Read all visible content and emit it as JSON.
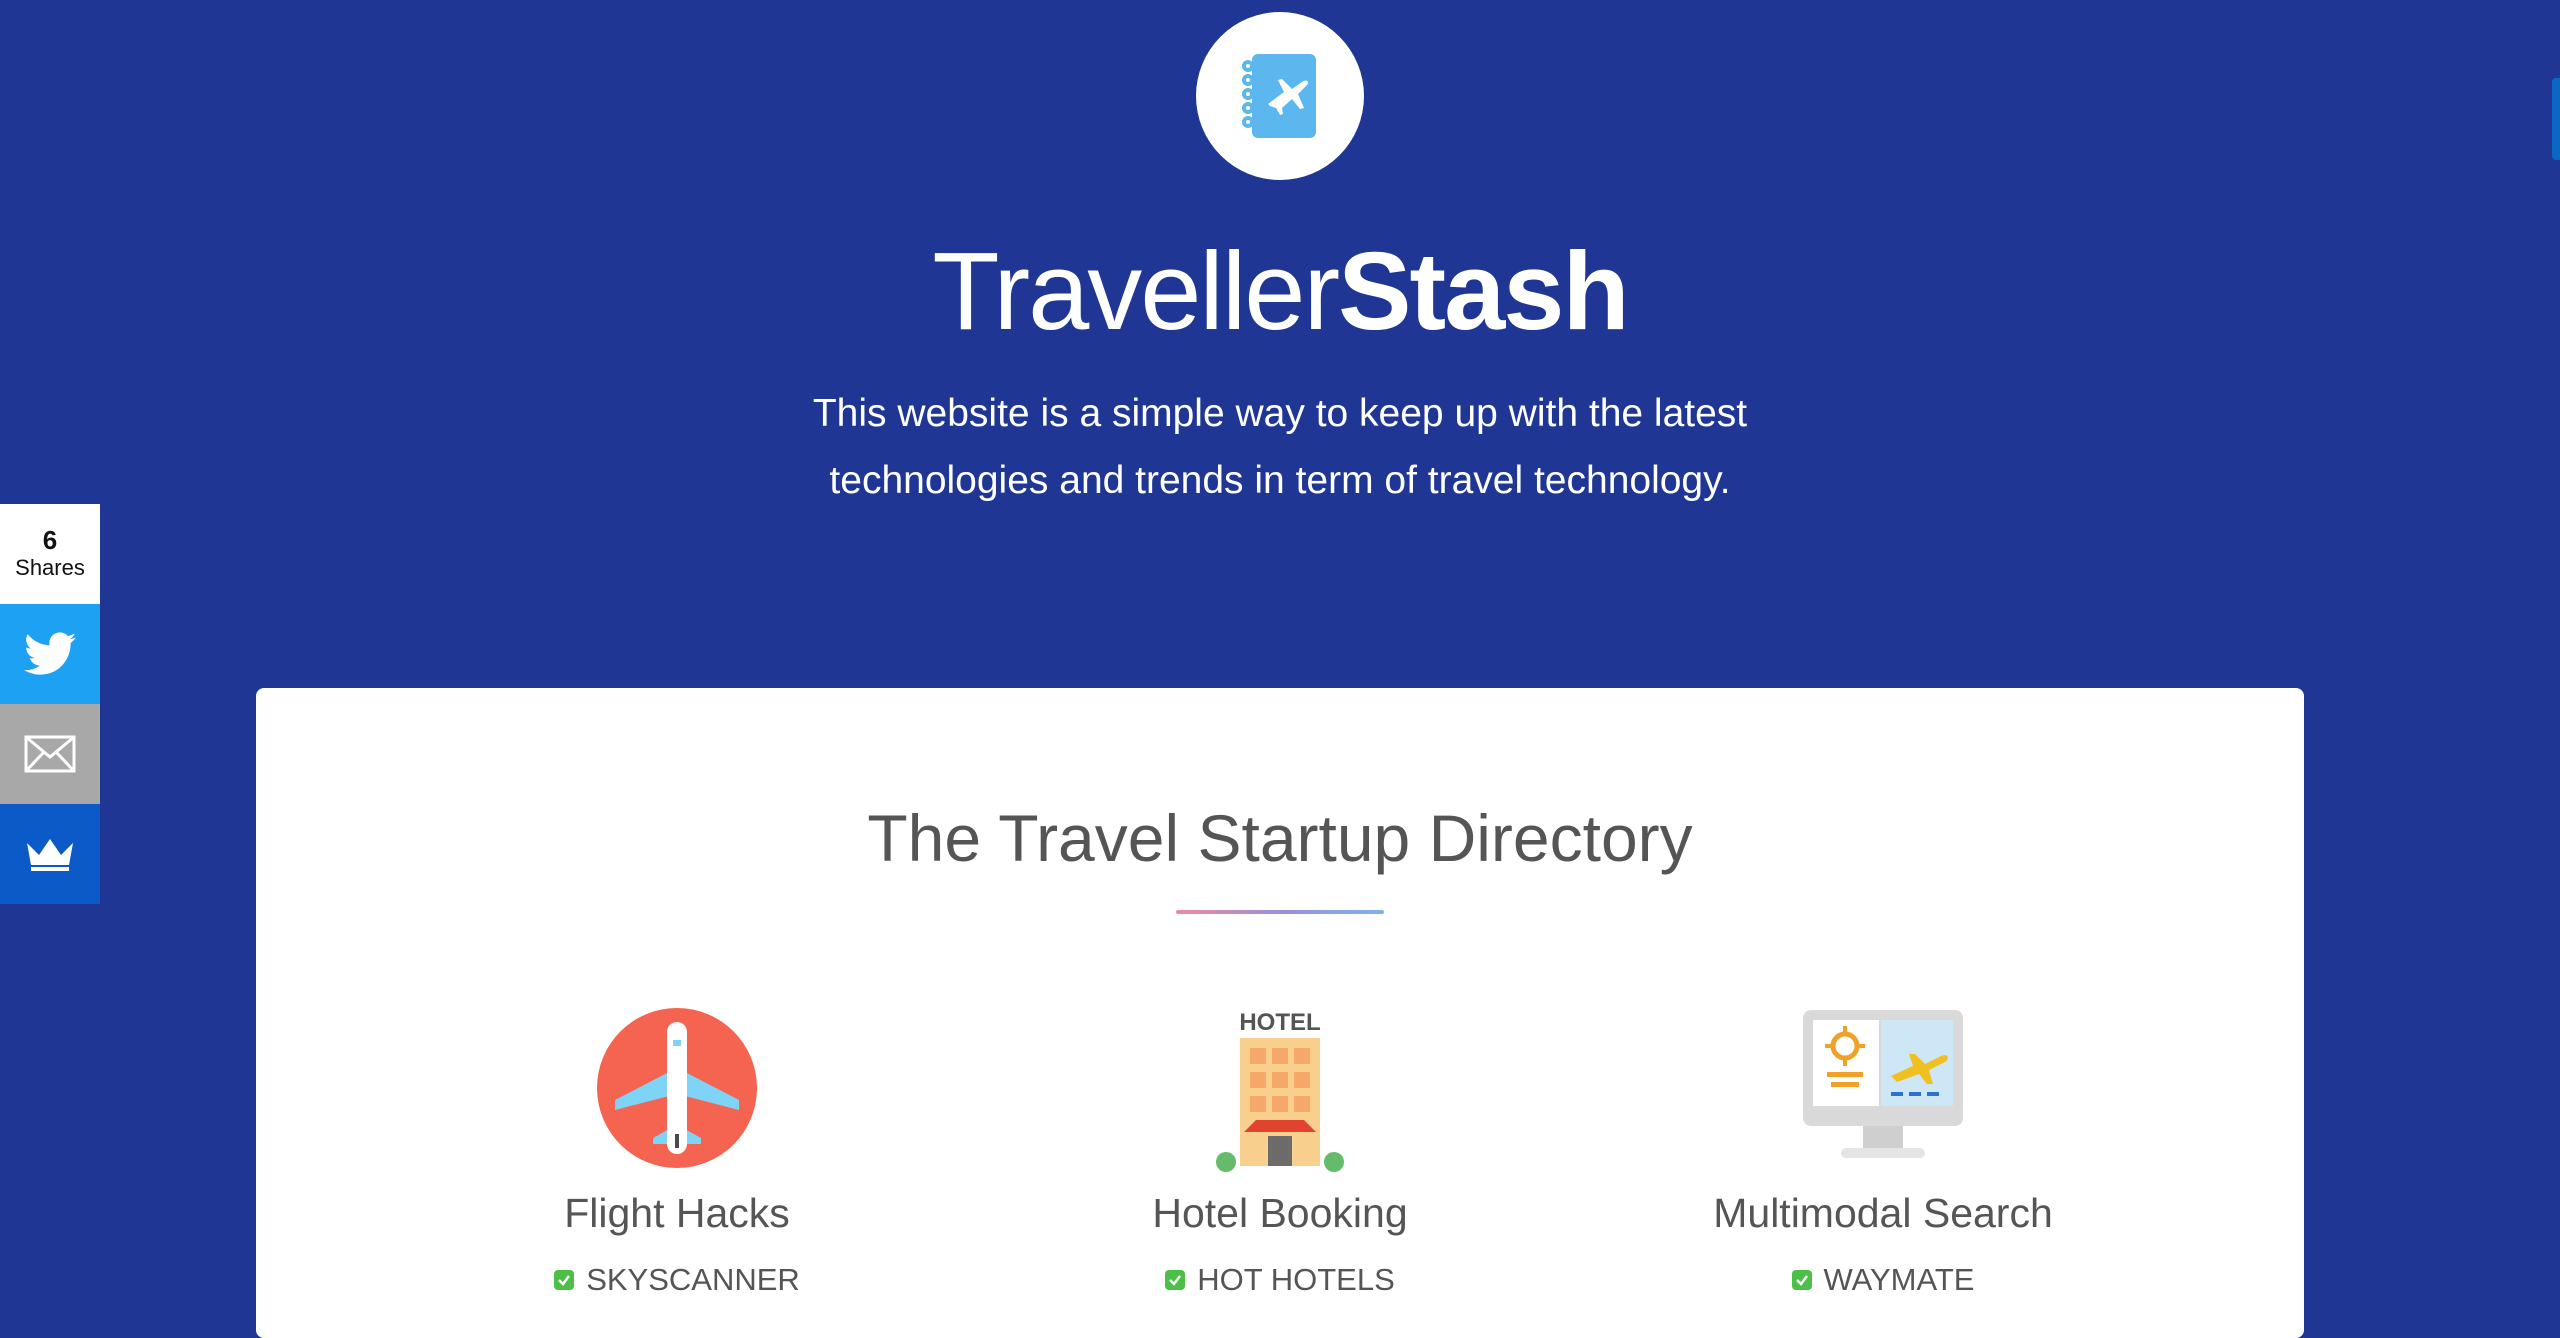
{
  "hero": {
    "title_light": "Traveller",
    "title_bold": "Stash",
    "tagline": "This website is a simple way to keep up with the latest technologies and trends in term of travel technology."
  },
  "share_bar": {
    "count": "6",
    "count_label": "Shares",
    "buttons": [
      "twitter-icon",
      "email-icon",
      "crown-icon"
    ]
  },
  "directory": {
    "title": "The Travel Startup Directory",
    "categories": [
      {
        "icon": "airplane-icon",
        "title": "Flight Hacks",
        "items": [
          "SKYSCANNER"
        ]
      },
      {
        "icon": "hotel-icon",
        "icon_text": "HOTEL",
        "title": "Hotel Booking",
        "items": [
          "HOT HOTELS"
        ]
      },
      {
        "icon": "monitor-icon",
        "title": "Multimodal Search",
        "items": [
          "WAYMATE"
        ]
      }
    ]
  },
  "colors": {
    "background": "#1f3694",
    "card": "#ffffff",
    "twitter": "#1da1f2",
    "email": "#a8a8a8",
    "crown": "#0b5ac8",
    "check": "#4cc046"
  }
}
